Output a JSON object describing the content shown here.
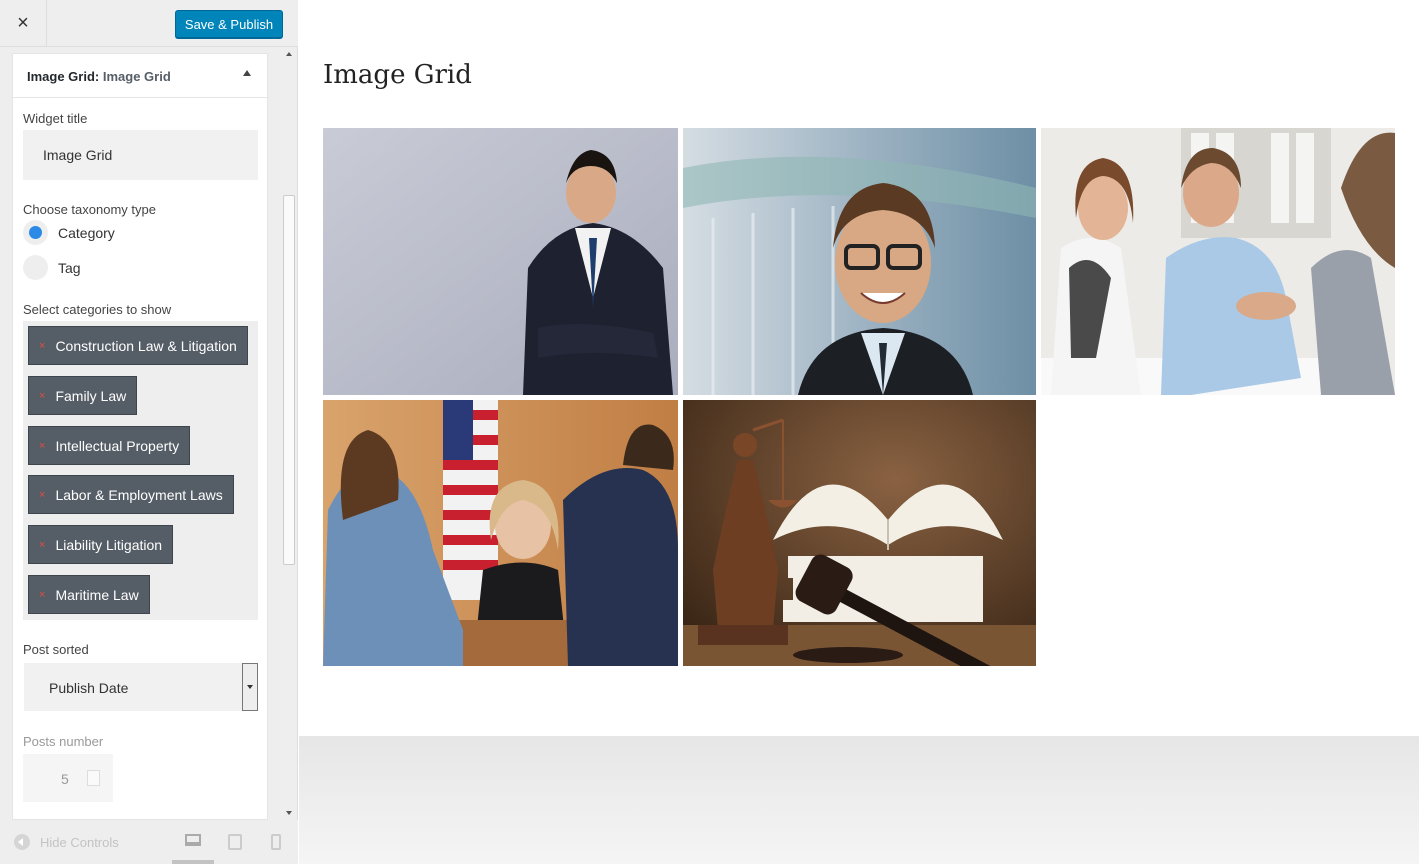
{
  "topbar": {
    "close_label": "×",
    "save_label": "Save & Publish"
  },
  "widget": {
    "title_prefix": "Image Grid:",
    "title_name": "Image Grid",
    "widget_title_label": "Widget title",
    "widget_title_value": "Image Grid",
    "taxonomy_label": "Choose taxonomy type",
    "taxonomy_options": [
      {
        "label": "Category",
        "checked": true
      },
      {
        "label": "Tag",
        "checked": false
      }
    ],
    "categories_label": "Select categories to show",
    "categories": [
      "Construction Law & Litigation",
      "Family Law",
      "Intellectual Property",
      "Labor & Employment Laws",
      "Liability Litigation",
      "Maritime Law"
    ],
    "chip_remove": "×",
    "sorted_label": "Post sorted",
    "sorted_value": "Publish Date",
    "number_label": "Posts number",
    "number_value": "5"
  },
  "footer": {
    "hide_controls": "Hide Controls"
  },
  "preview": {
    "title": "Image Grid",
    "images": [
      {
        "name": "businessman-arms-crossed"
      },
      {
        "name": "smiling-man-glasses"
      },
      {
        "name": "handshake-meeting"
      },
      {
        "name": "courtroom-judge"
      },
      {
        "name": "lady-justice-gavel-books"
      }
    ]
  }
}
